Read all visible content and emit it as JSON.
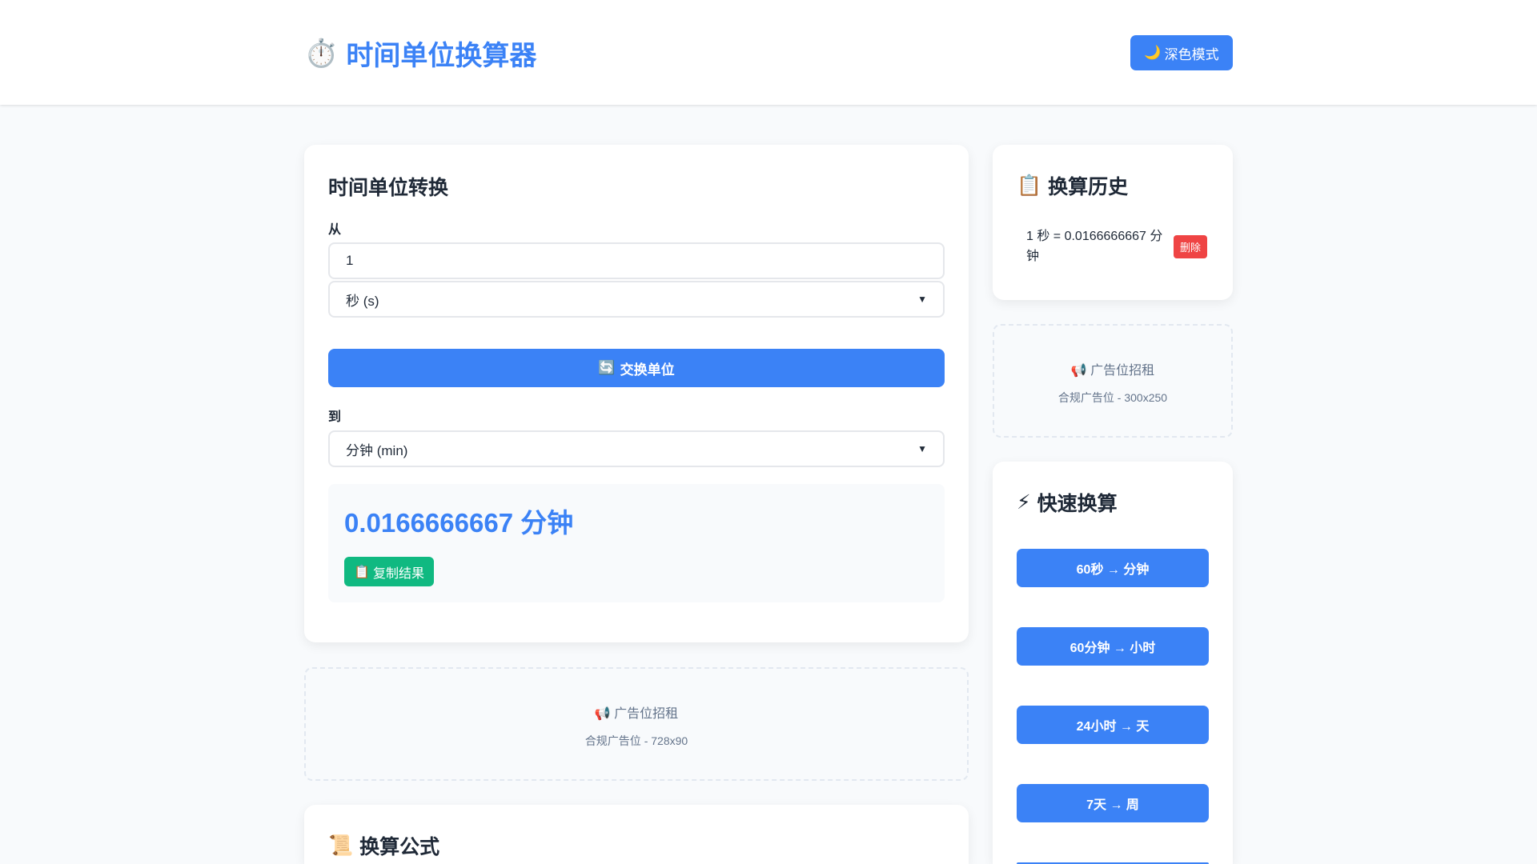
{
  "header": {
    "icon": "⏱️",
    "title": "时间单位换算器",
    "dark_mode_icon": "🌙",
    "dark_mode_label": "深色模式"
  },
  "converter": {
    "heading": "时间单位转换",
    "from_label": "从",
    "from_value": "1",
    "from_unit": "秒 (s)",
    "swap_icon": "🔄",
    "swap_label": "交换单位",
    "to_label": "到",
    "to_unit": "分钟 (min)",
    "result": "0.0166666667 分钟",
    "copy_icon": "📋",
    "copy_label": "复制结果"
  },
  "ad_main": {
    "icon": "📢",
    "title": "广告位招租",
    "subtitle": "合规广告位 - 728x90"
  },
  "formula": {
    "icon": "📜",
    "heading": "换算公式"
  },
  "history": {
    "icon": "📋",
    "heading": "换算历史",
    "items": [
      {
        "text": "1 秒 = 0.0166666667 分钟",
        "delete_label": "删除"
      }
    ]
  },
  "ad_side": {
    "icon": "📢",
    "title": "广告位招租",
    "subtitle": "合规广告位 - 300x250"
  },
  "quick": {
    "icon": "⚡",
    "heading": "快速换算",
    "buttons": [
      "60秒 → 分钟",
      "60分钟 → 小时",
      "24小时 → 天",
      "7天 → 周"
    ]
  }
}
